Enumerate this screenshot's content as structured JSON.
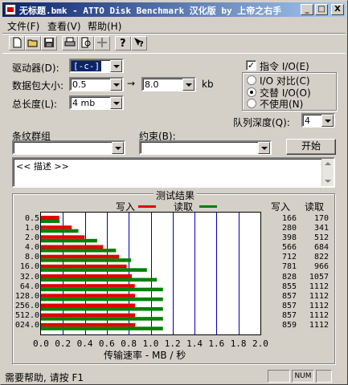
{
  "titlebar": {
    "title": "无标题.bmk - ATTO Disk Benchmark  汉化版 by 上帝之右手",
    "min": "_",
    "max": "□",
    "close": "X"
  },
  "menu": {
    "file": "文件(F)",
    "view": "查看(V)",
    "help": "帮助(H)"
  },
  "toolbar": {
    "icons": [
      "new-icon",
      "open-icon",
      "save-icon",
      "print-icon",
      "print-preview-icon",
      "move-icon",
      "help-icon",
      "context-help-icon"
    ]
  },
  "form": {
    "drive_label": "驱动器(D):",
    "drive_value": "[-c-]",
    "transfer_label": "数据包大小:",
    "transfer_from": "0.5",
    "transfer_arrow": "→",
    "transfer_to": "8.0",
    "transfer_unit": "kb",
    "total_label": "总长度(L):",
    "total_value": "4 mb",
    "direct_io_label": "指令 I/O(E)",
    "direct_io_checked": true,
    "io_compare_label": "I/O 对比(C)",
    "overlap_io_label": "交替 I/O(O)",
    "neither_label": "不使用(N)",
    "queue_label": "队列深度(Q):",
    "queue_value": "4",
    "stripe_label": "条纹群组",
    "constraint_label": "约束(B):",
    "start_button": "开始",
    "description": "<< 描述 >>"
  },
  "results": {
    "group_title": "测试结果",
    "write_legend": "写入",
    "read_legend": "读取",
    "write_header": "写入",
    "read_header": "读取",
    "write_color": "#e00000",
    "read_color": "#008000",
    "xlabel": "传输速率 - MB / 秒",
    "x_ticks": [
      "0.0",
      "0.2",
      "0.4",
      "0.6",
      "0.8",
      "1.0",
      "1.2",
      "1.4",
      "1.6",
      "1.8",
      "2.0"
    ]
  },
  "chart_data": {
    "type": "bar",
    "orientation": "horizontal",
    "categories": [
      "0.5",
      "1.0",
      "2.0",
      "4.0",
      "8.0",
      "16.0",
      "32.0",
      "64.0",
      "128.0",
      "256.0",
      "512.0",
      "024.0"
    ],
    "series": [
      {
        "name": "写入",
        "values": [
          166,
          280,
          398,
          566,
          712,
          781,
          828,
          855,
          857,
          857,
          857,
          859
        ]
      },
      {
        "name": "读取",
        "values": [
          170,
          341,
          512,
          684,
          822,
          966,
          1057,
          1112,
          1112,
          1112,
          1112,
          1112
        ]
      }
    ],
    "xlabel": "传输速率 - MB / 秒",
    "xlim": [
      0,
      2.0
    ],
    "x_unit_note": "MB/s axis; values are KB/s",
    "grid": true,
    "legend": "top"
  },
  "statusbar": {
    "text": "需要帮助, 请按 F1",
    "num": "NUM"
  }
}
